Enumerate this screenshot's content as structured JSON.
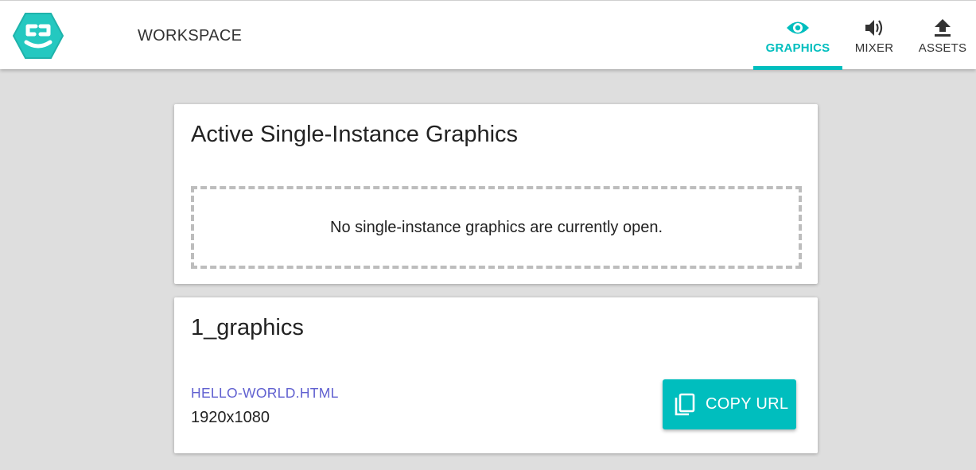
{
  "header": {
    "title": "WORKSPACE",
    "logo_icon": "nodecg-logo-icon",
    "accent_color": "#00bebe",
    "tabs": [
      {
        "label": "GRAPHICS",
        "icon": "eye-icon",
        "active": true
      },
      {
        "label": "MIXER",
        "icon": "volume-icon",
        "active": false
      },
      {
        "label": "ASSETS",
        "icon": "upload-icon",
        "active": false
      }
    ]
  },
  "active_graphics": {
    "title": "Active Single-Instance Graphics",
    "empty_message": "No single-instance graphics are currently open."
  },
  "bundle": {
    "title": "1_graphics",
    "graphics": [
      {
        "file": "HELLO-WORLD.HTML",
        "resolution": "1920x1080",
        "copy_label": "COPY URL",
        "copy_icon": "copy-icon"
      }
    ]
  }
}
